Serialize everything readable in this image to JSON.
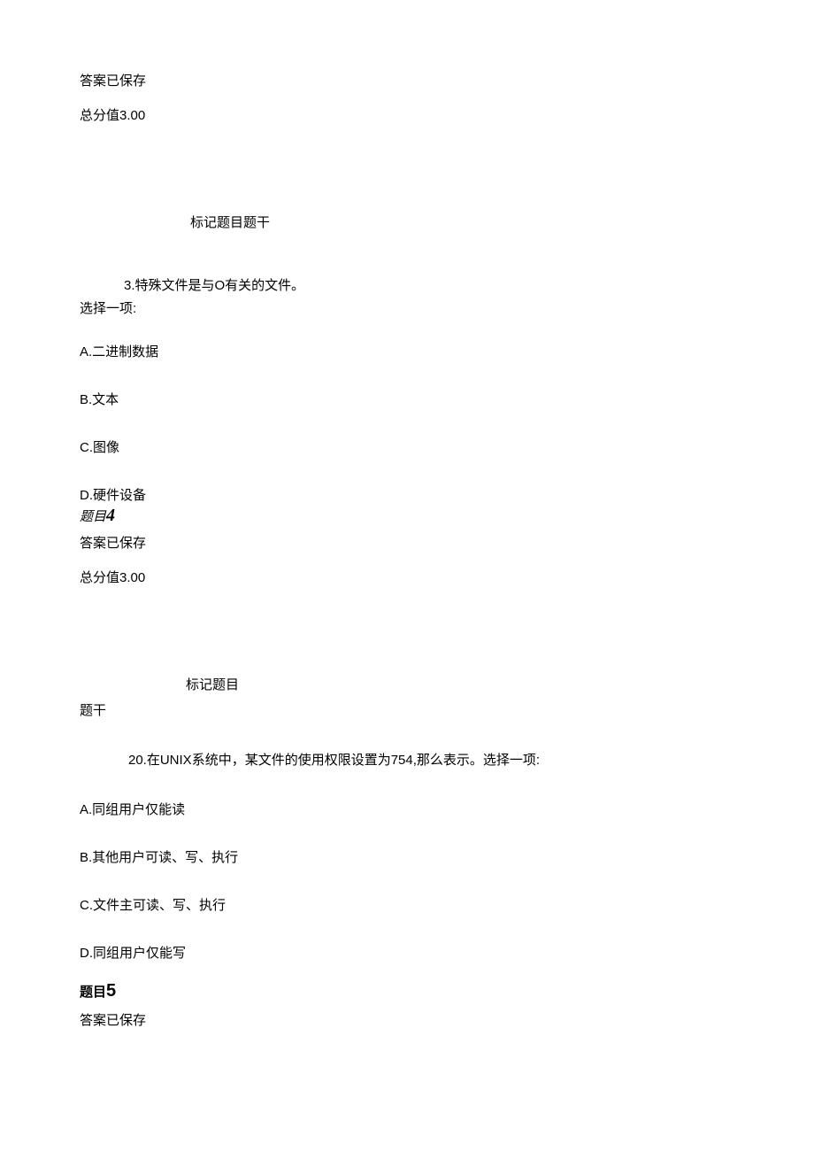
{
  "block1": {
    "saved": "答案已保存",
    "score": "总分值3.00"
  },
  "q3": {
    "mark": "标记题目题干",
    "text": "3.特殊文件是与O有关的文件。",
    "select": "选择一项:",
    "opt_a": "A.二进制数据",
    "opt_b": "B.文本",
    "opt_c": "C.图像",
    "opt_d": "D.硬件设备"
  },
  "q4_header": {
    "label": "题目",
    "num": "4",
    "saved": "答案已保存",
    "score": "总分值3.00"
  },
  "q4": {
    "mark": "标记题目",
    "tigan": "题干",
    "text": "20.在UNIX系统中，某文件的使用权限设置为754,那么表示。选择一项:",
    "opt_a": "A.同组用户仅能读",
    "opt_b": "B.其他用户可读、写、执行",
    "opt_c": "C.文件主可读、写、执行",
    "opt_d": "D.同组用户仅能写"
  },
  "q5_header": {
    "label": "题目",
    "num": "5",
    "saved": "答案已保存"
  }
}
